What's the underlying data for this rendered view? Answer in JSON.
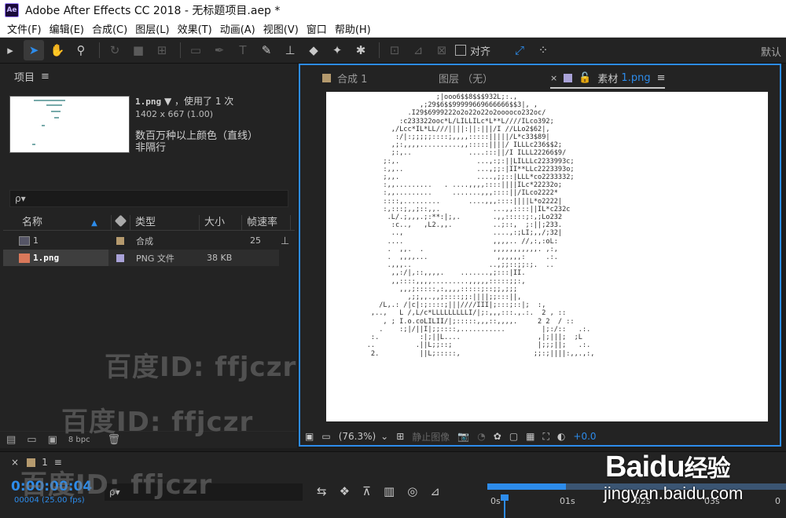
{
  "window": {
    "app_icon": "Ae",
    "title": "Adobe After Effects CC 2018 - 无标题项目.aep *"
  },
  "menu": [
    "文件(F)",
    "编辑(E)",
    "合成(C)",
    "图层(L)",
    "效果(T)",
    "动画(A)",
    "视图(V)",
    "窗口",
    "帮助(H)"
  ],
  "toolbar": {
    "align_label": "对齐",
    "workspace_label": "默认"
  },
  "project": {
    "title": "项目",
    "file_name": "1.png",
    "used_text": "，使用了 1 次",
    "dimensions": "1402 x 667 (1.00)",
    "color_desc": "数百万种以上颜色（直线）",
    "alpha_desc": "非隔行",
    "search_placeholder": "ρ▾",
    "columns": {
      "name": "名称",
      "type": "类型",
      "size": "大小",
      "fps": "帧速率"
    },
    "items": [
      {
        "name": "1",
        "type": "合成",
        "size": "",
        "fps": "25",
        "label_color": "#b59a6e"
      },
      {
        "name": "1.png",
        "type": "PNG 文件",
        "size": "38 KB",
        "fps": "",
        "label_color": "#a9a2d8"
      }
    ],
    "bpc": "8 bpc"
  },
  "viewer": {
    "tabs": [
      {
        "label": "合成 1",
        "color": "#b59a6e"
      },
      {
        "label": "图层 （无）"
      },
      {
        "label": "素材",
        "file": "1.png",
        "color": "#a9a2d8"
      }
    ],
    "ascii_art": [
      "                           ;|ooo6$$8$$$932L;:.,",
      "                       ,;29$6$$99999669666666$$3|, ,",
      "                    .I29$6999222o2o22o22o2ooooco232oc/",
      "                  :c233322ooc*L/LILLILc*L**L////ILco392;",
      "                ,/Lcc*IL*LL///||||:||:|||/I //LLo2$62|,",
      "                 :/|:;;;;;::::;,,,,:::::|||||/L*c33$89|",
      "                ,;:,,,,..........,,:::::||||/ ILLLc236$$2;",
      "                ;:,..              ....:::||/I ILLL22266$9/",
      "              ;:,.                   ...,:;:||LILLLc2233993c;",
      "              :,,..                  ...,;;:|II**LLc2223393o;",
      "              ;,,.                   ....,;;::|LLL*co2233332;",
      "              :,,.........   . ....,,,,::::||||ILc*22232o;",
      "              :,,.........     .......,,,::::||/ILco2222*",
      "              ::::,.........       ....,,,::::||||L*o2222|",
      "              :,:::;,,;::,,.             ...,,::::||IL*c232c",
      "               .L/.;,,,.;:**:|;,.        .,,:::::;:,;Lo232",
      "                :c..,   ,L2.,,.          ..;::,  ;:||;233.",
      "                ..,                      ....,:;LI;,,/;32|",
      "               ....                      ,,,,.. //,:,:oL:",
      "               .  ,,.  .                 ,,,,,,,,,,,. ,:,",
      "               .  ,,,,...                 ,,,,,,:     .:.",
      "               .,,,..                   ..,;;::;;:;.  ..",
      "                ,,:/|,::,,,,.    .......,;:::|II.",
      "                ,,::::,,,,.........,,,,,:::::;;:,",
      "                  ,,,;:::::,:,,,,:::::;::;;,;;;",
      "                    ,;;,,.,,;::::;;:||||;;:::||,",
      "             /L,.: /|c|:;::::;|||////III|;:::;::|;  :,",
      "           ,..,   L /,L/c*LLLLLLLLLI/|;:,,,:::.,.:.  2 , ::",
      "              , ; I.o.coLILII/|;:::::,,,::,,,,.     2 2  / ::",
      "             .    :;|/||I|;;::::,...........         |;:/::   .:.",
      "           :.          :|;||L....                   ,|;|||;  ;L",
      "          ..          .||L;;::;                     |;;;||;   .:.",
      "           2.          ||L;:::::,                  ;;:;||||:,,.,:,"
    ],
    "zoom": "(76.3%)",
    "show_snapshot": "静止图像",
    "exposure": "+0.0"
  },
  "timeline": {
    "comp_name": "1",
    "timecode": "0:00:00:04",
    "frame_info": "00004 (25.00 fps)",
    "search_placeholder": "ρ▾",
    "ruler": [
      "0s",
      "01s",
      "02s",
      "03s",
      "0"
    ]
  },
  "watermarks": {
    "baidu_id": "百度ID: ffjczr",
    "baidu_brand": "Baidu",
    "baidu_jingyan": "经验",
    "baidu_url": "jingyan.baidu.com"
  },
  "colors": {
    "accent": "#2d8ceb",
    "panel_bg": "#232323",
    "comp_label": "#b59a6e",
    "footage_label": "#a9a2d8"
  }
}
